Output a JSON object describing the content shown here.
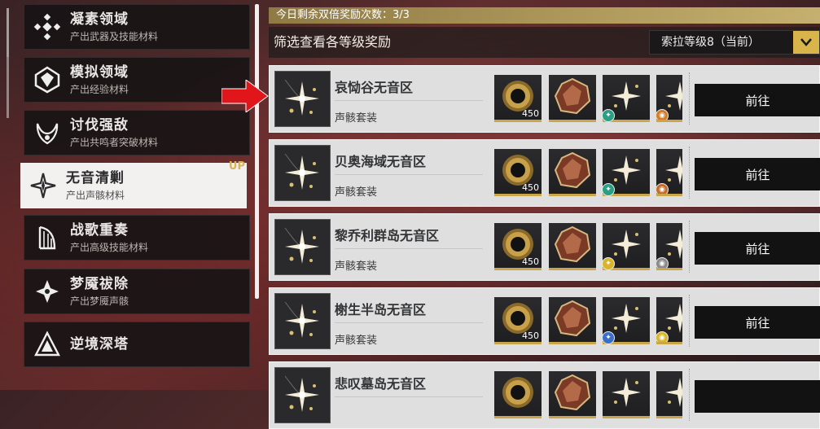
{
  "categories": [
    {
      "title": "凝素领域",
      "sub": "产出武器及技能材料"
    },
    {
      "title": "模拟领域",
      "sub": "产出经验材料"
    },
    {
      "title": "讨伐强敌",
      "sub": "产出共鸣者突破材料"
    },
    {
      "title": "无音清剿",
      "sub": "产出声骸材料",
      "badge": "UP"
    },
    {
      "title": "战歌重奏",
      "sub": "产出高级技能材料"
    },
    {
      "title": "梦魇祓除",
      "sub": "产出梦魇声骸"
    },
    {
      "title": "逆境深塔",
      "sub": ""
    }
  ],
  "header": {
    "bonus": "今日剩余双倍奖励次数：3/3",
    "filter_label": "筛选查看各等级奖励",
    "level_select": "索拉等级8（当前）"
  },
  "rows": [
    {
      "name": "哀恸谷无音区",
      "sub": "声骸套装",
      "qty": "450",
      "go": "前往",
      "badges": [
        "#2a9f86",
        "#d97b22"
      ]
    },
    {
      "name": "贝奥海域无音区",
      "sub": "声骸套装",
      "qty": "450",
      "go": "前往",
      "badges": [
        "#2a9f86",
        "#c46d2a"
      ]
    },
    {
      "name": "黎乔利群岛无音区",
      "sub": "声骸套装",
      "qty": "450",
      "go": "前往",
      "badges": [
        "#d9b52a",
        "#8a8a8a"
      ]
    },
    {
      "name": "榭生半岛无音区",
      "sub": "声骸套装",
      "qty": "450",
      "go": "前往",
      "badges": [
        "#3b6fc7",
        "#d9b52a"
      ]
    },
    {
      "name": "悲叹墓岛无音区",
      "sub": "",
      "qty": "",
      "go": "",
      "badges": []
    }
  ],
  "colors": {
    "accent": "#d9b44a",
    "bonus_bar": "#b09a5c",
    "go_button": "#121212"
  }
}
